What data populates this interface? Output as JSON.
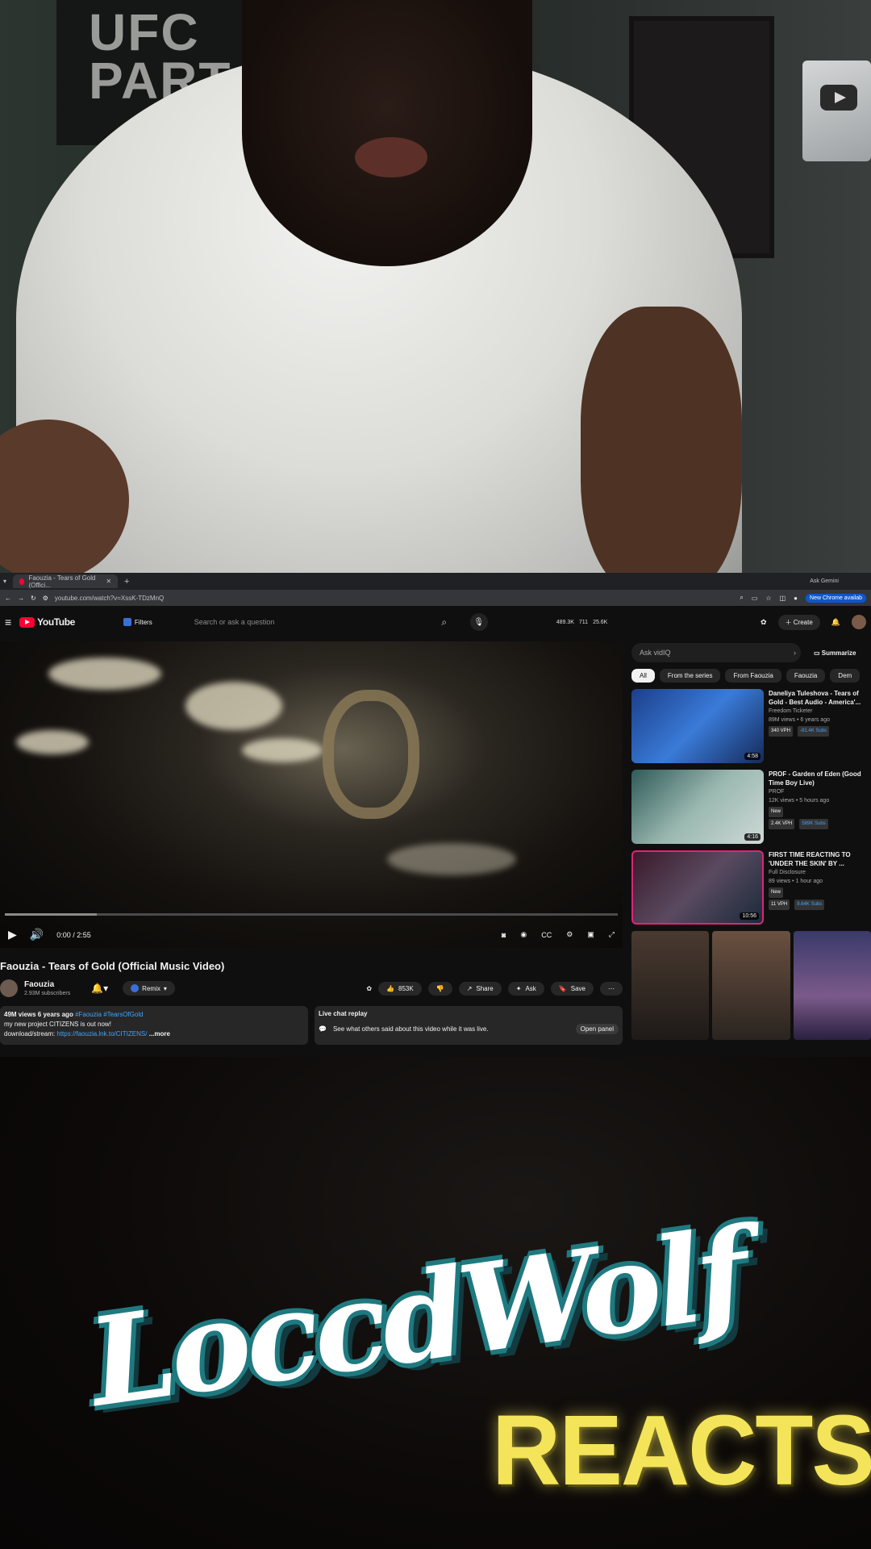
{
  "webcam": {
    "poster_text": "UFC PART"
  },
  "browser": {
    "tab_title": "Faouzia - Tears of Gold (Offici...",
    "new_tab": "+",
    "ask_gemini": "Ask Gemini",
    "url": "youtube.com/watch?v=XssK-TDzMnQ",
    "new_chrome": "New Chrome availab"
  },
  "youtube": {
    "logo": "YouTube",
    "filters": "Filters",
    "search_placeholder": "Search or ask a question",
    "stats": [
      "489.3K",
      "711",
      "25.6K"
    ],
    "create": "Create",
    "player": {
      "time": "0:00 / 2:55",
      "progress": 0.0,
      "buffered": 0.15
    },
    "video_title": "Faouzia - Tears of Gold (Official Music Video)",
    "channel": {
      "name": "Faouzia",
      "subs": "2.93M subscribers"
    },
    "remix": "Remix",
    "likes": "853K",
    "share": "Share",
    "ask": "Ask",
    "save": "Save",
    "description": {
      "meta": "49M views  6 years ago",
      "tags": "#Faouzia #TearsOfGold",
      "line2": "my new project CITIZENS is out now!",
      "line3_prefix": "download/stream: ",
      "link": "https://faouzia.lnk.to/CITIZENS/",
      "more": "...more"
    },
    "live_chat": {
      "title": "Live chat replay",
      "text": "See what others said about this video while it was live.",
      "open": "Open panel"
    },
    "sidebar": {
      "ask_placeholder": "Ask vidIQ",
      "summarize": "Summarize",
      "chips": [
        "All",
        "From the series",
        "From Faouzia",
        "Faouzia",
        "Dem"
      ],
      "recs": [
        {
          "title": "Daneliya Tuleshova - Tears of Gold - Best Audio - America'...",
          "channel": "Freedom Ticketer",
          "meta": "89M views • 6 years ago",
          "vph": "340 VPH",
          "score": "-81.4K Subs",
          "duration": "4:58"
        },
        {
          "title": "PROF - Garden of Eden (Good Time Boy Live)",
          "channel": "PROF",
          "meta": "12K views • 5 hours ago",
          "badge": "New",
          "vph": "2.4K VPH",
          "score": "589K Subs",
          "duration": "4:16"
        },
        {
          "title": "FIRST TIME REACTING TO 'UNDER THE SKIN' BY ...",
          "channel": "Full Disclosure",
          "meta": "89 views • 1 hour ago",
          "badge": "New",
          "vph": "11 VPH",
          "score": "8.64K Subs",
          "duration": "10:56"
        }
      ]
    }
  },
  "overlay": {
    "wolf": "LoccdWolf",
    "reacts": "REACTS"
  },
  "colors": {
    "youtube_red": "#ff0033",
    "reacts_yellow": "#f3e45a",
    "wolf_teal": "#1f7a80"
  }
}
